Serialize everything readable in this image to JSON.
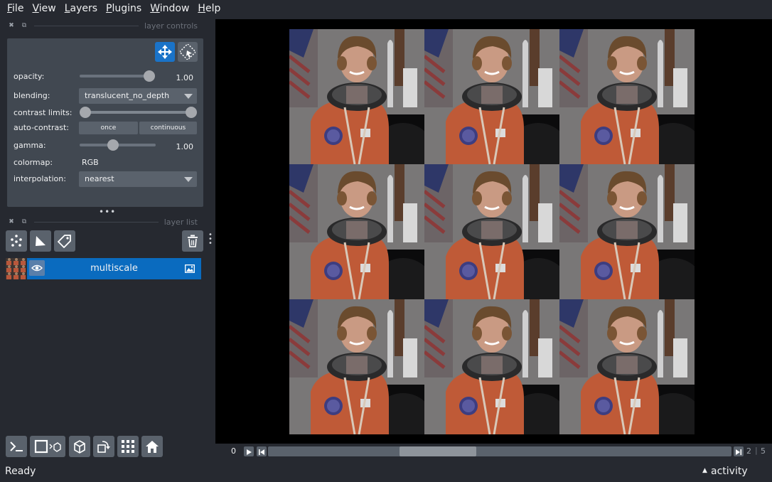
{
  "menu": [
    {
      "label": "File",
      "u": "F",
      "rest": "ile"
    },
    {
      "label": "View",
      "u": "V",
      "rest": "iew"
    },
    {
      "label": "Layers",
      "u": "L",
      "rest": "ayers"
    },
    {
      "label": "Plugins",
      "u": "P",
      "rest": "lugins"
    },
    {
      "label": "Window",
      "u": "W",
      "rest": "indow"
    },
    {
      "label": "Help",
      "u": "H",
      "rest": "elp"
    }
  ],
  "layer_controls": {
    "title": "layer controls",
    "opacity_label": "opacity:",
    "opacity_value": "1.00",
    "blending_label": "blending:",
    "blending_value": "translucent_no_depth",
    "contrast_label": "contrast limits:",
    "autocontrast_label": "auto-contrast:",
    "once_label": "once",
    "continuous_label": "continuous",
    "gamma_label": "gamma:",
    "gamma_value": "1.00",
    "colormap_label": "colormap:",
    "colormap_value": "RGB",
    "interpolation_label": "interpolation:",
    "interpolation_value": "nearest"
  },
  "layer_list": {
    "title": "layer list",
    "layers": [
      {
        "name": "multiscale"
      }
    ]
  },
  "dims": {
    "axis_index": "0",
    "current": "2",
    "total": "5",
    "slider_fraction": 0.34
  },
  "status": {
    "text": "Ready",
    "activity": "activity"
  },
  "colors": {
    "accent": "#0a6bbf",
    "background": "#262930",
    "panel": "#414851",
    "button": "#5a626c"
  }
}
